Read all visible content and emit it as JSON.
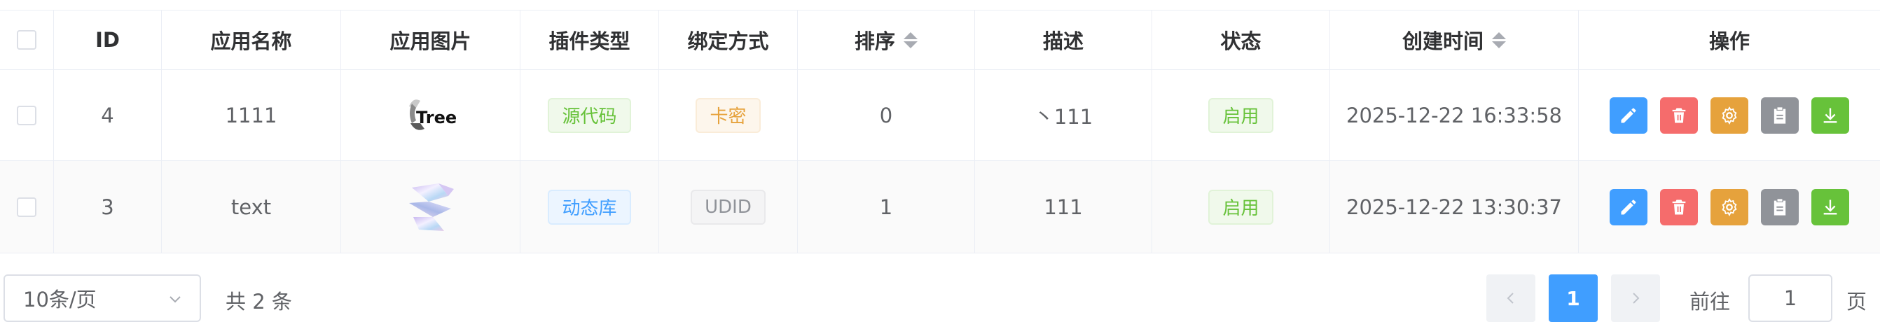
{
  "table": {
    "headers": {
      "id": "ID",
      "name": "应用名称",
      "image": "应用图片",
      "plugin_type": "插件类型",
      "bind_mode": "绑定方式",
      "sort": "排序",
      "desc": "描述",
      "status": "状态",
      "created": "创建时间",
      "actions": "操作"
    },
    "rows": [
      {
        "id": "4",
        "name": "1111",
        "image_icon": "treepay-logo",
        "plugin_type": "源代码",
        "bind_mode": "卡密",
        "sort": "0",
        "desc": "丶111",
        "status": "启用",
        "created": "2025-12-22 16:33:58"
      },
      {
        "id": "3",
        "name": "text",
        "image_icon": "holographic-shard-logo",
        "plugin_type": "动态库",
        "bind_mode": "UDID",
        "sort": "1",
        "desc": "111",
        "status": "启用",
        "created": "2025-12-22 13:30:37"
      }
    ]
  },
  "pagination": {
    "page_size": "10条/页",
    "total": "共 2 条",
    "current_page": "1",
    "goto_label": "前往",
    "goto_value": "1",
    "goto_suffix": "页"
  },
  "colors": {
    "primary": "#409eff",
    "danger": "#f56c6c",
    "warning": "#e6a23c",
    "info": "#909399",
    "success": "#67c23a"
  }
}
